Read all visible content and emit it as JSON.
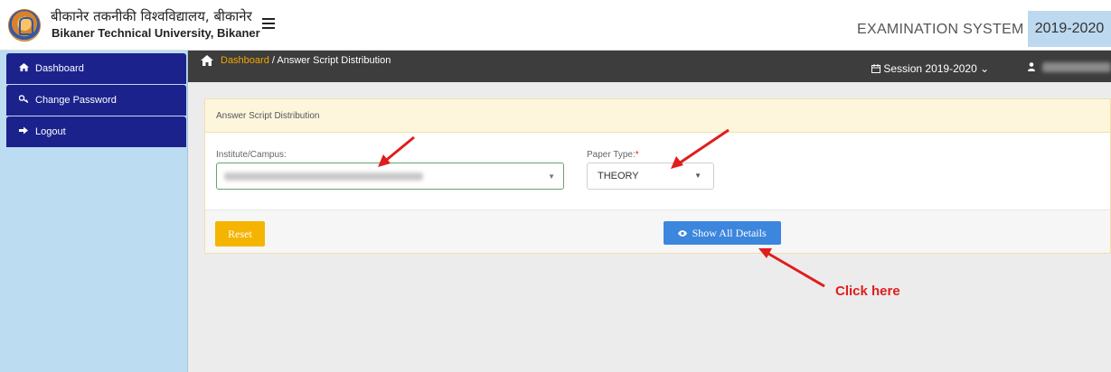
{
  "header": {
    "uni_name_hindi": "बीकानेर तकनीकी विश्वविद्यालय, बीकानेर",
    "uni_name_english": "Bikaner Technical University, Bikaner",
    "system_title": "EXAMINATION SYSTEM",
    "system_year": "2019-2020"
  },
  "sidebar": {
    "items": [
      {
        "label": "Dashboard",
        "icon": "home-icon"
      },
      {
        "label": "Change Password",
        "icon": "key-icon"
      },
      {
        "label": "Logout",
        "icon": "sign-out-icon"
      }
    ]
  },
  "breadcrumb": {
    "home": "Dashboard",
    "separator": " / ",
    "current": "Answer Script Distribution"
  },
  "session": {
    "label": "Session",
    "value": "2019-2020",
    "caret": "⌄"
  },
  "panel": {
    "title": "Answer Script Distribution",
    "institute_label": "Institute/Campus:",
    "paper_type_label": "Paper Type:",
    "required_mark": "*",
    "paper_type_value": "THEORY",
    "reset_label": "Reset",
    "show_label": "Show All Details"
  },
  "annotation": {
    "text": "Click here",
    "color": "#e01d1d"
  },
  "colors": {
    "sidebar_item": "#1c228c",
    "sidebar_bg": "#bcdcf2",
    "crumb_bar": "#3d3d3d",
    "crumb_link": "#f0a500",
    "reset_button": "#f5b400",
    "show_button": "#3c86dd",
    "panel_header": "#fdf6dd"
  }
}
